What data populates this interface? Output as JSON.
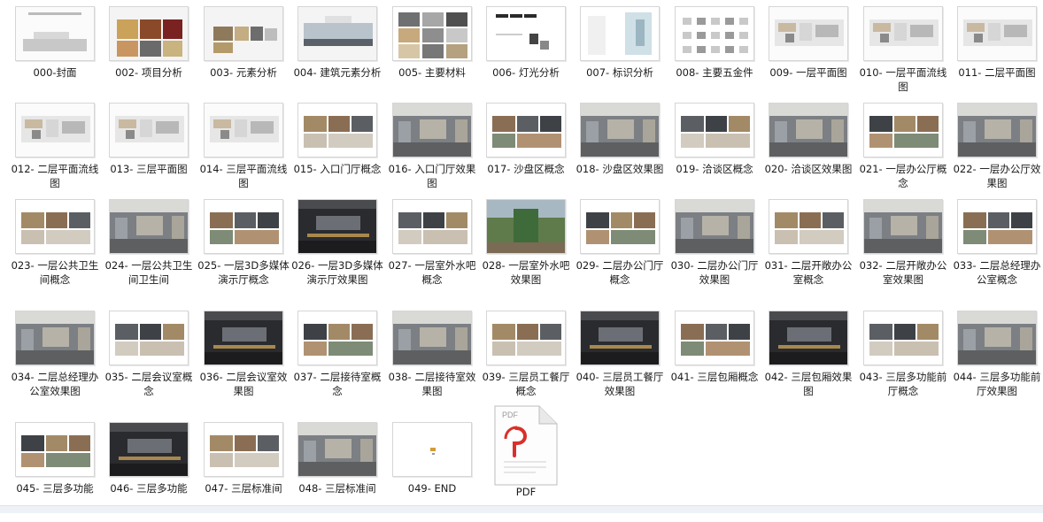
{
  "folder": {
    "files": [
      {
        "label": "000-封面",
        "theme": "cover"
      },
      {
        "label": "002- 项目分析",
        "theme": "collage"
      },
      {
        "label": "003- 元素分析",
        "theme": "collage2"
      },
      {
        "label": "004- 建筑元素分析",
        "theme": "arch"
      },
      {
        "label": "005- 主要材料",
        "theme": "material"
      },
      {
        "label": "006- 灯光分析",
        "theme": "light"
      },
      {
        "label": "007- 标识分析",
        "theme": "sign"
      },
      {
        "label": "008- 主要五金件",
        "theme": "hardware"
      },
      {
        "label": "009- 一层平面图",
        "theme": "plan"
      },
      {
        "label": "010- 一层平面流线图",
        "theme": "plan"
      },
      {
        "label": "011- 二层平面图",
        "theme": "plan"
      },
      {
        "label": "012- 二层平面流线图",
        "theme": "plan"
      },
      {
        "label": "013- 三层平面图",
        "theme": "plan"
      },
      {
        "label": "014- 三层平面流线图",
        "theme": "plan"
      },
      {
        "label": "015- 入口门厅概念",
        "theme": "concept"
      },
      {
        "label": "016- 入口门厅效果图",
        "theme": "render"
      },
      {
        "label": "017- 沙盘区概念",
        "theme": "concept"
      },
      {
        "label": "018- 沙盘区效果图",
        "theme": "render"
      },
      {
        "label": "019- 洽谈区概念",
        "theme": "concept"
      },
      {
        "label": "020- 洽谈区效果图",
        "theme": "render"
      },
      {
        "label": "021- 一层办公厅概念",
        "theme": "concept"
      },
      {
        "label": "022- 一层办公厅效果图",
        "theme": "render"
      },
      {
        "label": "023- 一层公共卫生间概念",
        "theme": "concept"
      },
      {
        "label": "024- 一层公共卫生间卫生间",
        "theme": "render"
      },
      {
        "label": "025- 一层3D多媒体演示厅概念",
        "theme": "concept"
      },
      {
        "label": "026- 一层3D多媒体演示厅效果图",
        "theme": "dark"
      },
      {
        "label": "027- 一层室外水吧概念",
        "theme": "concept"
      },
      {
        "label": "028- 一层室外水吧效果图",
        "theme": "green"
      },
      {
        "label": "029- 二层办公门厅概念",
        "theme": "concept"
      },
      {
        "label": "030- 二层办公门厅效果图",
        "theme": "render"
      },
      {
        "label": "031- 二层开敞办公室概念",
        "theme": "concept"
      },
      {
        "label": "032- 二层开敞办公室效果图",
        "theme": "render"
      },
      {
        "label": "033- 二层总经理办公室概念",
        "theme": "concept"
      },
      {
        "label": "034- 二层总经理办公室效果图",
        "theme": "render"
      },
      {
        "label": "035- 二层会议室概念",
        "theme": "concept"
      },
      {
        "label": "036- 二层会议室效果图",
        "theme": "dark"
      },
      {
        "label": "037- 二层接待室概念",
        "theme": "concept"
      },
      {
        "label": "038- 二层接待室效果图",
        "theme": "render"
      },
      {
        "label": "039- 三层员工餐厅概念",
        "theme": "concept"
      },
      {
        "label": "040- 三层员工餐厅效果图",
        "theme": "dark"
      },
      {
        "label": "041- 三层包厢概念",
        "theme": "concept"
      },
      {
        "label": "042- 三层包厢效果图",
        "theme": "dark"
      },
      {
        "label": "043- 三层多功能前厅概念",
        "theme": "concept"
      },
      {
        "label": "044- 三层多功能前厅效果图",
        "theme": "render"
      },
      {
        "label": "045- 三层多功能",
        "theme": "concept"
      },
      {
        "label": "046- 三层多功能",
        "theme": "dark"
      },
      {
        "label": "047- 三层标准间",
        "theme": "concept"
      },
      {
        "label": "048- 三层标准间",
        "theme": "render"
      },
      {
        "label": "049- END",
        "theme": "end"
      },
      {
        "label": "PDF",
        "theme": "pdf"
      }
    ],
    "pdf_badge": "PDF",
    "colors": {
      "pdf_red": "#d9302b",
      "accent": "#2a6db5"
    }
  }
}
